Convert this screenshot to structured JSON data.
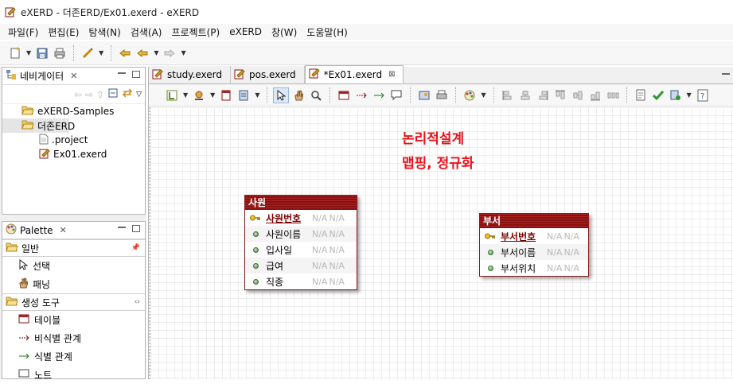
{
  "window": {
    "title": "eXERD - 더존ERD/Ex01.exerd - eXERD"
  },
  "menu": [
    "파일(F)",
    "편집(E)",
    "탐색(N)",
    "검색(A)",
    "프로젝트(P)",
    "eXERD",
    "창(W)",
    "도움말(H)"
  ],
  "navigator": {
    "title": "네비게이터",
    "tree": [
      {
        "label": "eXERD-Samples",
        "icon": "folder-open-icon"
      },
      {
        "label": "더존ERD",
        "icon": "folder-open-icon"
      },
      {
        "label": ".project",
        "icon": "file-icon"
      },
      {
        "label": "Ex01.exerd",
        "icon": "exerd-file-icon"
      }
    ]
  },
  "palette": {
    "title": "Palette",
    "groups": [
      {
        "label": "일반",
        "items": [
          "선택",
          "패닝"
        ]
      },
      {
        "label": "생성 도구",
        "items": [
          "테이블",
          "비식별 관계",
          "식별 관계",
          "노트"
        ]
      }
    ]
  },
  "tabs": [
    {
      "label": "study.exerd"
    },
    {
      "label": "pos.exerd"
    },
    {
      "label": "*Ex01.exerd"
    }
  ],
  "diagram": {
    "note_lines": [
      "논리적설계",
      "맵핑, 정규화"
    ],
    "note_color": "#e8141c",
    "header_color": "#8a1010",
    "entities": [
      {
        "name": "사원",
        "columns": [
          {
            "name": "사원번호",
            "pk": true,
            "type": "N/A",
            "domain": "N/A"
          },
          {
            "name": "사원이름",
            "pk": false,
            "type": "N/A",
            "domain": "N/A"
          },
          {
            "name": "입사일",
            "pk": false,
            "type": "N/A",
            "domain": "N/A"
          },
          {
            "name": "급여",
            "pk": false,
            "type": "N/A",
            "domain": "N/A"
          },
          {
            "name": "직종",
            "pk": false,
            "type": "N/A",
            "domain": "N/A"
          }
        ]
      },
      {
        "name": "부서",
        "columns": [
          {
            "name": "부서번호",
            "pk": true,
            "type": "N/A",
            "domain": "N/A"
          },
          {
            "name": "부서이름",
            "pk": false,
            "type": "N/A",
            "domain": "N/A"
          },
          {
            "name": "부서위치",
            "pk": false,
            "type": "N/A",
            "domain": "N/A"
          }
        ]
      }
    ]
  }
}
